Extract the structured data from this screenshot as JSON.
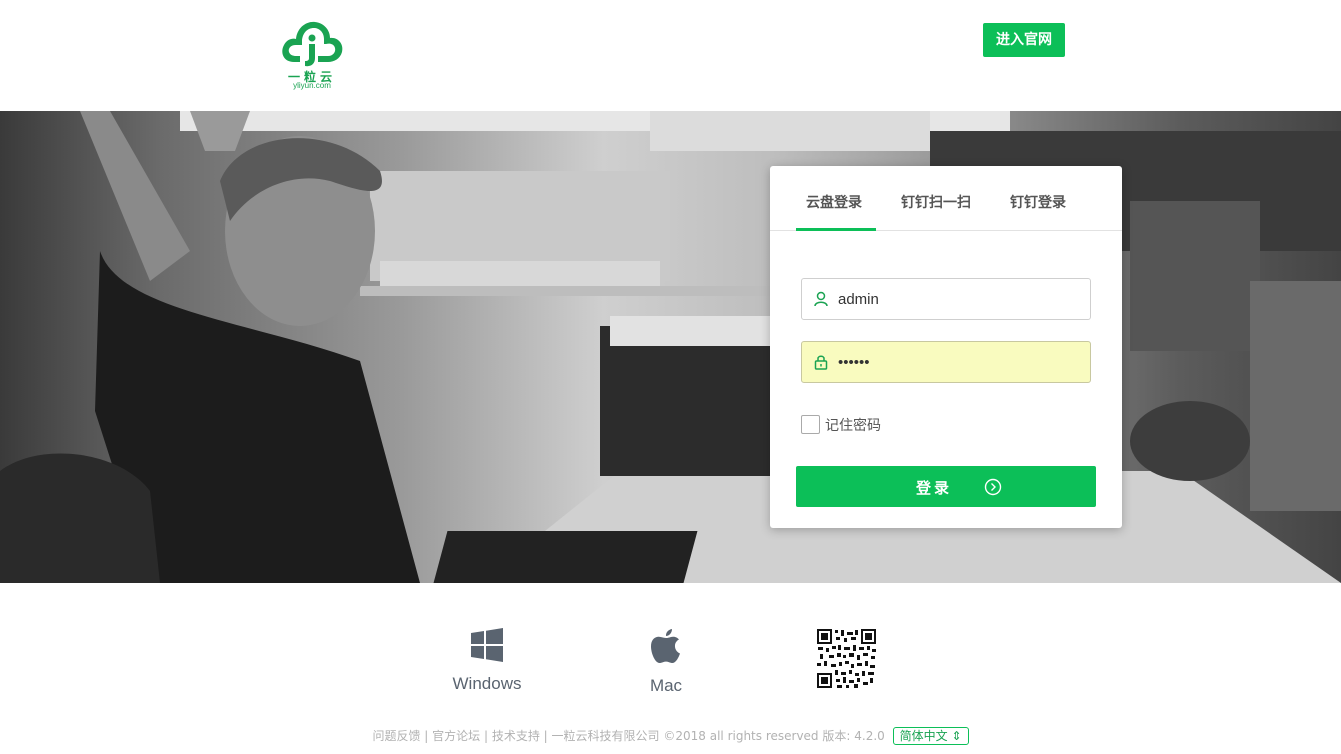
{
  "header": {
    "logo_cn": "一粒云",
    "logo_en": "yliyun.com",
    "site_button": "进入官网"
  },
  "login": {
    "tabs": [
      {
        "label": "云盘登录",
        "active": true
      },
      {
        "label": "钉钉扫一扫",
        "active": false
      },
      {
        "label": "钉钉登录",
        "active": false
      }
    ],
    "username": "admin",
    "password": "••••••",
    "remember_label": "记住密码",
    "submit_label": "登录"
  },
  "downloads": [
    {
      "label": "Windows",
      "icon": "windows-icon"
    },
    {
      "label": "Mac",
      "icon": "apple-icon"
    }
  ],
  "qr_icon": "qr-code-icon",
  "footer": {
    "links": [
      "问题反馈",
      "官方论坛",
      "技术支持"
    ],
    "separator": " | ",
    "company": "一粒云科技有限公司",
    "copyright": "©2018 all rights reserved",
    "version": "版本: 4.2.0",
    "language": "简体中文"
  },
  "colors": {
    "brand": "#0cbf58",
    "logo": "#1aa352",
    "autofill": "#f9fbbf"
  }
}
